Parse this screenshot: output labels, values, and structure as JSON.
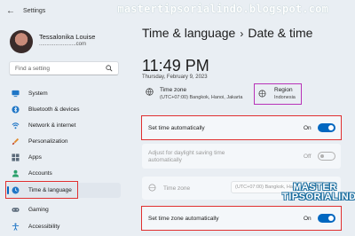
{
  "window": {
    "title": "Settings",
    "back_glyph": "←"
  },
  "watermark": "mastertipsorialindo.blogspot.com",
  "user": {
    "name": "Tessalonika Louise",
    "email": ".........................com"
  },
  "search": {
    "placeholder": "Find a setting"
  },
  "sidebar": {
    "items": [
      {
        "label": "System",
        "icon": "monitor-icon"
      },
      {
        "label": "Bluetooth & devices",
        "icon": "bluetooth-icon"
      },
      {
        "label": "Network & internet",
        "icon": "wifi-icon"
      },
      {
        "label": "Personalization",
        "icon": "brush-icon"
      },
      {
        "label": "Apps",
        "icon": "apps-icon"
      },
      {
        "label": "Accounts",
        "icon": "person-icon"
      },
      {
        "label": "Time & language",
        "icon": "globe-clock-icon",
        "active": true
      },
      {
        "label": "Gaming",
        "icon": "gamepad-icon"
      },
      {
        "label": "Accessibility",
        "icon": "accessibility-icon"
      }
    ]
  },
  "header": {
    "section": "Time & language",
    "chevron": "›",
    "page": "Date & time"
  },
  "clock": {
    "time": "11:49 PM",
    "date": "Thursday, February 9, 2023"
  },
  "timezone": {
    "label": "Time zone",
    "value": "(UTC+07:00) Bangkok, Hanoi, Jakarta"
  },
  "region": {
    "label": "Region",
    "value": "Indonesia"
  },
  "settings": {
    "set_time_auto": {
      "label": "Set time automatically",
      "state": "On"
    },
    "dst": {
      "label_line1": "Adjust for daylight saving time",
      "label_line2": "automatically",
      "state": "Off"
    },
    "time_zone_row": {
      "label": "Time zone",
      "value": "(UTC+07:00) Bangkok, Hanoi, Jakarta",
      "chevron": "⌄"
    },
    "set_tz_auto": {
      "label": "Set time zone automatically",
      "state": "On"
    }
  },
  "brand": {
    "line1": "MASTER",
    "line2": "TIPSORIALINDO"
  },
  "colors": {
    "accent": "#0067c0",
    "highlight_red": "#e03030",
    "highlight_purple": "#b833b8"
  }
}
